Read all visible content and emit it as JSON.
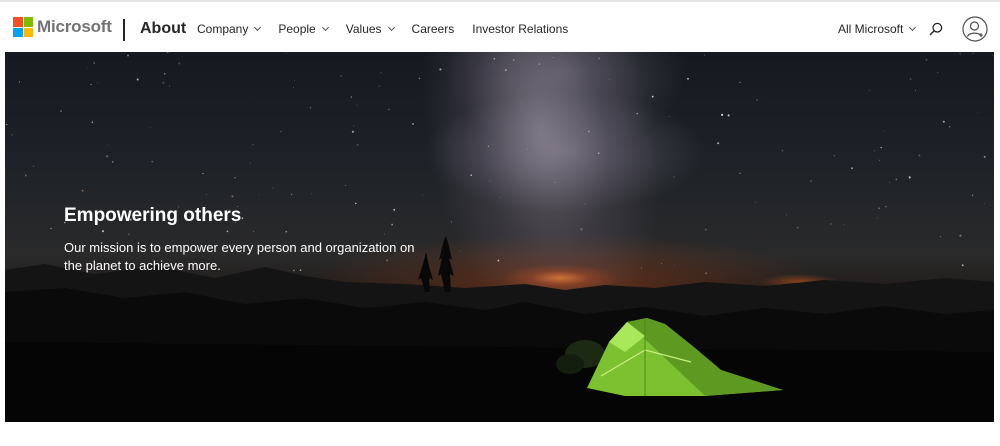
{
  "header": {
    "brand": "Microsoft",
    "section": "About",
    "logo_colors": [
      "#f25022",
      "#7fba00",
      "#00a4ef",
      "#ffb900"
    ],
    "nav": [
      {
        "label": "Company",
        "has_dropdown": true,
        "icon": "chevron-down-icon"
      },
      {
        "label": "People",
        "has_dropdown": true,
        "icon": "chevron-down-icon"
      },
      {
        "label": "Values",
        "has_dropdown": true,
        "icon": "chevron-down-icon"
      },
      {
        "label": "Careers",
        "has_dropdown": false
      },
      {
        "label": "Investor Relations",
        "has_dropdown": false
      }
    ],
    "all_microsoft": "All Microsoft",
    "search_icon": "search-icon",
    "account_icon": "account-avatar-icon"
  },
  "hero": {
    "title": "Empowering others",
    "text": "Our mission is to empower every person and organization on the planet to achieve more.",
    "image": "night sky over mountains with a glowing green tent",
    "tent_color": "#8fd13a"
  }
}
